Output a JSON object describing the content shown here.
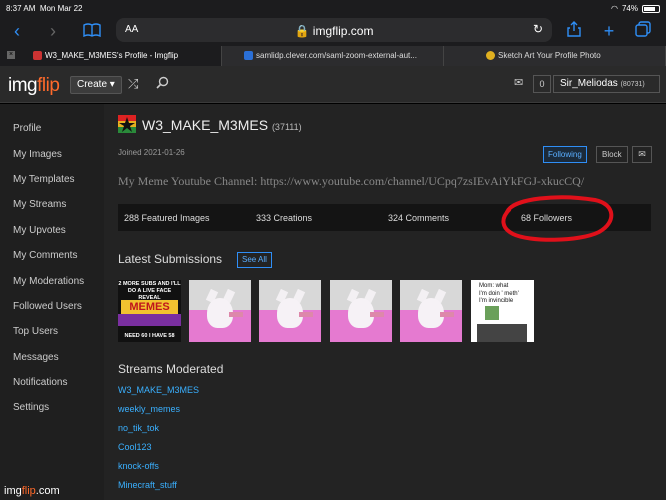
{
  "status_bar": {
    "time": "8:37 AM",
    "date": "Mon Mar 22",
    "battery": "74%"
  },
  "browser": {
    "aa_label": "AA",
    "url": "imgflip.com",
    "tabs": [
      {
        "label": "W3_MAKE_M3MES's Profile - Imgflip"
      },
      {
        "label": "samlidp.clever.com/saml-zoom-external-aut..."
      },
      {
        "label": "Sketch Art Your Profile Photo"
      }
    ]
  },
  "header": {
    "logo_main": "img",
    "logo_accent": "flip",
    "create_label": "Create",
    "notifications": "0",
    "username": "Sir_Meliodas",
    "user_points": "(80731)"
  },
  "sidebar": {
    "items": [
      {
        "label": "Profile"
      },
      {
        "label": "My Images"
      },
      {
        "label": "My Templates"
      },
      {
        "label": "My Streams"
      },
      {
        "label": "My Upvotes"
      },
      {
        "label": "My Comments"
      },
      {
        "label": "My Moderations"
      },
      {
        "label": "Followed Users"
      },
      {
        "label": "Top Users"
      },
      {
        "label": "Messages"
      },
      {
        "label": "Notifications"
      },
      {
        "label": "Settings"
      }
    ]
  },
  "profile": {
    "name": "W3_MAKE_M3MES",
    "points": "(37111)",
    "joined": "Joined 2021-01-26",
    "follow_label": "Following",
    "block_label": "Block",
    "bio": "My Meme Youtube Channel: https://www.youtube.com/channel/UCpq7zsIEvAiYkFGJ-xkucCQ/",
    "stats": {
      "featured": "288 Featured Images",
      "creations": "333 Creations",
      "comments": "324 Comments",
      "followers": "68 Followers"
    }
  },
  "submissions": {
    "title": "Latest Submissions",
    "see_all": "See All",
    "meme_top": "2 MORE SUBS AND I'LL DO A LIVE FACE REVEAL",
    "meme_big": "MEMES",
    "meme_bottom": "NEED 60 I HAVE 58",
    "text_thumb_line1": "Mom: what",
    "text_thumb_line2": "I'm doin ' meth'",
    "text_thumb_line3": "I'm invincible"
  },
  "streams": {
    "title": "Streams Moderated",
    "items": [
      {
        "label": "W3_MAKE_M3MES"
      },
      {
        "label": "weekly_memes"
      },
      {
        "label": "no_tik_tok"
      },
      {
        "label": "Cool123"
      },
      {
        "label": "knock-offs"
      },
      {
        "label": "Minecraft_stuff"
      }
    ]
  },
  "footer": {
    "domain": ".com"
  },
  "colors": {
    "accent_blue": "#2f8ef6",
    "logo_orange": "#ff6a2b",
    "annotation_red": "#e0101a"
  }
}
